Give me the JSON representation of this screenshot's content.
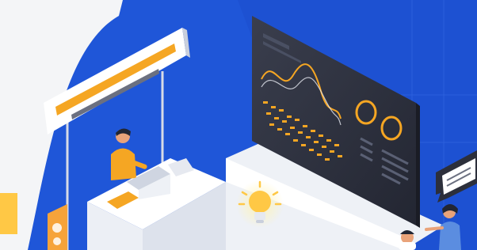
{
  "scene": {
    "type": "isometric-illustration",
    "colors": {
      "background_light": "#f4f5f7",
      "blue_primary": "#1f56d8",
      "blue_deep": "#1846c2",
      "panel_dark": "#2c2f3b",
      "accent_orange": "#f5a623",
      "accent_yellow": "#ffc845",
      "white": "#ffffff"
    },
    "elements": [
      "hanging-sign",
      "booth-desk",
      "worker-character",
      "laptop",
      "dashboard-screen",
      "lightbulb-icon",
      "speech-bubble-icon",
      "presenter-character",
      "audience-character"
    ]
  }
}
